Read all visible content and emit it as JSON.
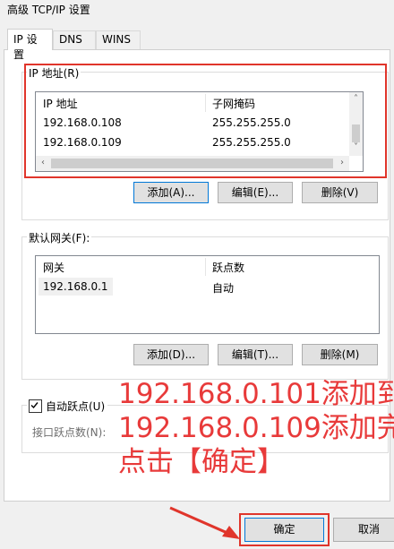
{
  "window": {
    "title": "高级 TCP/IP 设置"
  },
  "tabs": [
    {
      "label": "IP 设置",
      "active": true
    },
    {
      "label": "DNS",
      "active": false
    },
    {
      "label": "WINS",
      "active": false
    }
  ],
  "ip_group": {
    "legend": "IP 地址(R)",
    "columns": [
      "IP 地址",
      "子网掩码"
    ],
    "rows": [
      {
        "ip": "192.168.0.108",
        "mask": "255.255.255.0"
      },
      {
        "ip": "192.168.0.109",
        "mask": "255.255.255.0"
      }
    ],
    "buttons": {
      "add": "添加(A)...",
      "edit": "编辑(E)...",
      "delete": "删除(V)"
    }
  },
  "gateway_group": {
    "legend": "默认网关(F):",
    "columns": [
      "网关",
      "跃点数"
    ],
    "rows": [
      {
        "gateway": "192.168.0.1",
        "metric": "自动"
      }
    ],
    "buttons": {
      "add": "添加(D)...",
      "edit": "编辑(T)...",
      "delete": "删除(M)"
    }
  },
  "metric": {
    "auto_label": "自动跃点(U)",
    "auto_checked": true,
    "interface_label": "接口跃点数(N):"
  },
  "annotation": {
    "lines": [
      "192.168.0.101添加到",
      "192.168.0.109添加完",
      "点击【确定】"
    ],
    "color": "#e83a3a"
  },
  "footer": {
    "ok": "确定",
    "cancel": "取消"
  }
}
